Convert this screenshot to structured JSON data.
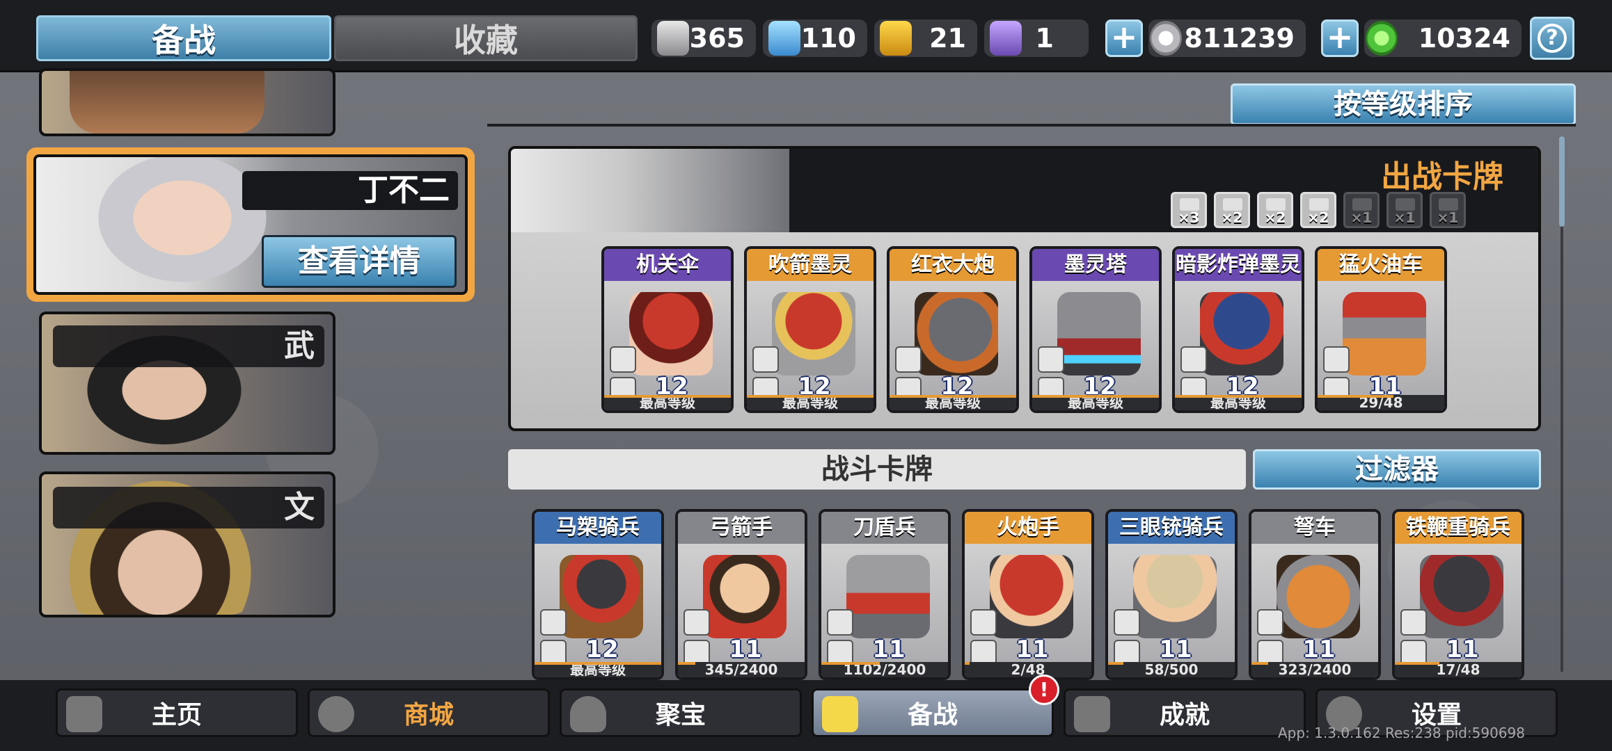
{
  "top_tabs": {
    "active": "备战",
    "inactive": "收藏"
  },
  "resources": [
    {
      "icon": "silver-feather-icon",
      "value": "365"
    },
    {
      "icon": "blue-crystal-icon",
      "value": "110"
    },
    {
      "icon": "gold-shield-icon",
      "value": "21"
    },
    {
      "icon": "purple-mask-icon",
      "value": "1"
    },
    {
      "icon": "silver-coin-icon",
      "value": "811239"
    },
    {
      "icon": "jade-coin-icon",
      "value": "10324"
    }
  ],
  "help_label": "?",
  "plus_label": "+",
  "heroes": {
    "selected": {
      "name": "丁不二",
      "details_label": "查看详情"
    },
    "others": [
      {
        "tag": "武"
      },
      {
        "tag": "文"
      }
    ]
  },
  "sort_label": "按等级排序",
  "deck": {
    "title": "出战卡牌",
    "modifiers": [
      "×3",
      "×2",
      "×2",
      "×2",
      "×1",
      "×1",
      "×1"
    ],
    "cards": [
      {
        "name": "机关伞",
        "level": "12",
        "progress": "最高等级",
        "band": "purple"
      },
      {
        "name": "吹箭墨灵",
        "level": "12",
        "progress": "最高等级",
        "band": "orange"
      },
      {
        "name": "红衣大炮",
        "level": "12",
        "progress": "最高等级",
        "band": "orange"
      },
      {
        "name": "墨灵塔",
        "level": "12",
        "progress": "最高等级",
        "band": "purple"
      },
      {
        "name": "暗影炸弹墨灵",
        "level": "12",
        "progress": "最高等级",
        "band": "purple"
      },
      {
        "name": "猛火油车",
        "level": "11",
        "progress": "29/48",
        "band": "orange"
      }
    ]
  },
  "battle": {
    "title": "战斗卡牌",
    "filter_label": "过滤器",
    "cards": [
      {
        "name": "马槊骑兵",
        "level": "12",
        "progress": "最高等级",
        "band": "blue"
      },
      {
        "name": "弓箭手",
        "level": "11",
        "progress": "345/2400",
        "band": "grey"
      },
      {
        "name": "刀盾兵",
        "level": "11",
        "progress": "1102/2400",
        "band": "grey"
      },
      {
        "name": "火炮手",
        "level": "11",
        "progress": "2/48",
        "band": "orange"
      },
      {
        "name": "三眼铳骑兵",
        "level": "11",
        "progress": "58/500",
        "band": "blue"
      },
      {
        "name": "弩车",
        "level": "11",
        "progress": "323/2400",
        "band": "grey"
      },
      {
        "name": "铁鞭重骑兵",
        "level": "11",
        "progress": "17/48",
        "band": "orange"
      }
    ]
  },
  "bottom_nav": [
    {
      "label": "主页",
      "icon": "home-icon"
    },
    {
      "label": "商城",
      "icon": "shop-icon"
    },
    {
      "label": "聚宝",
      "icon": "treasure-icon"
    },
    {
      "label": "备战",
      "icon": "cards-icon"
    },
    {
      "label": "成就",
      "icon": "achievement-icon"
    },
    {
      "label": "设置",
      "icon": "gear-icon"
    }
  ],
  "notification_badge": "!",
  "version_text": "App: 1.3.0.162 Res:238 pid:590698"
}
